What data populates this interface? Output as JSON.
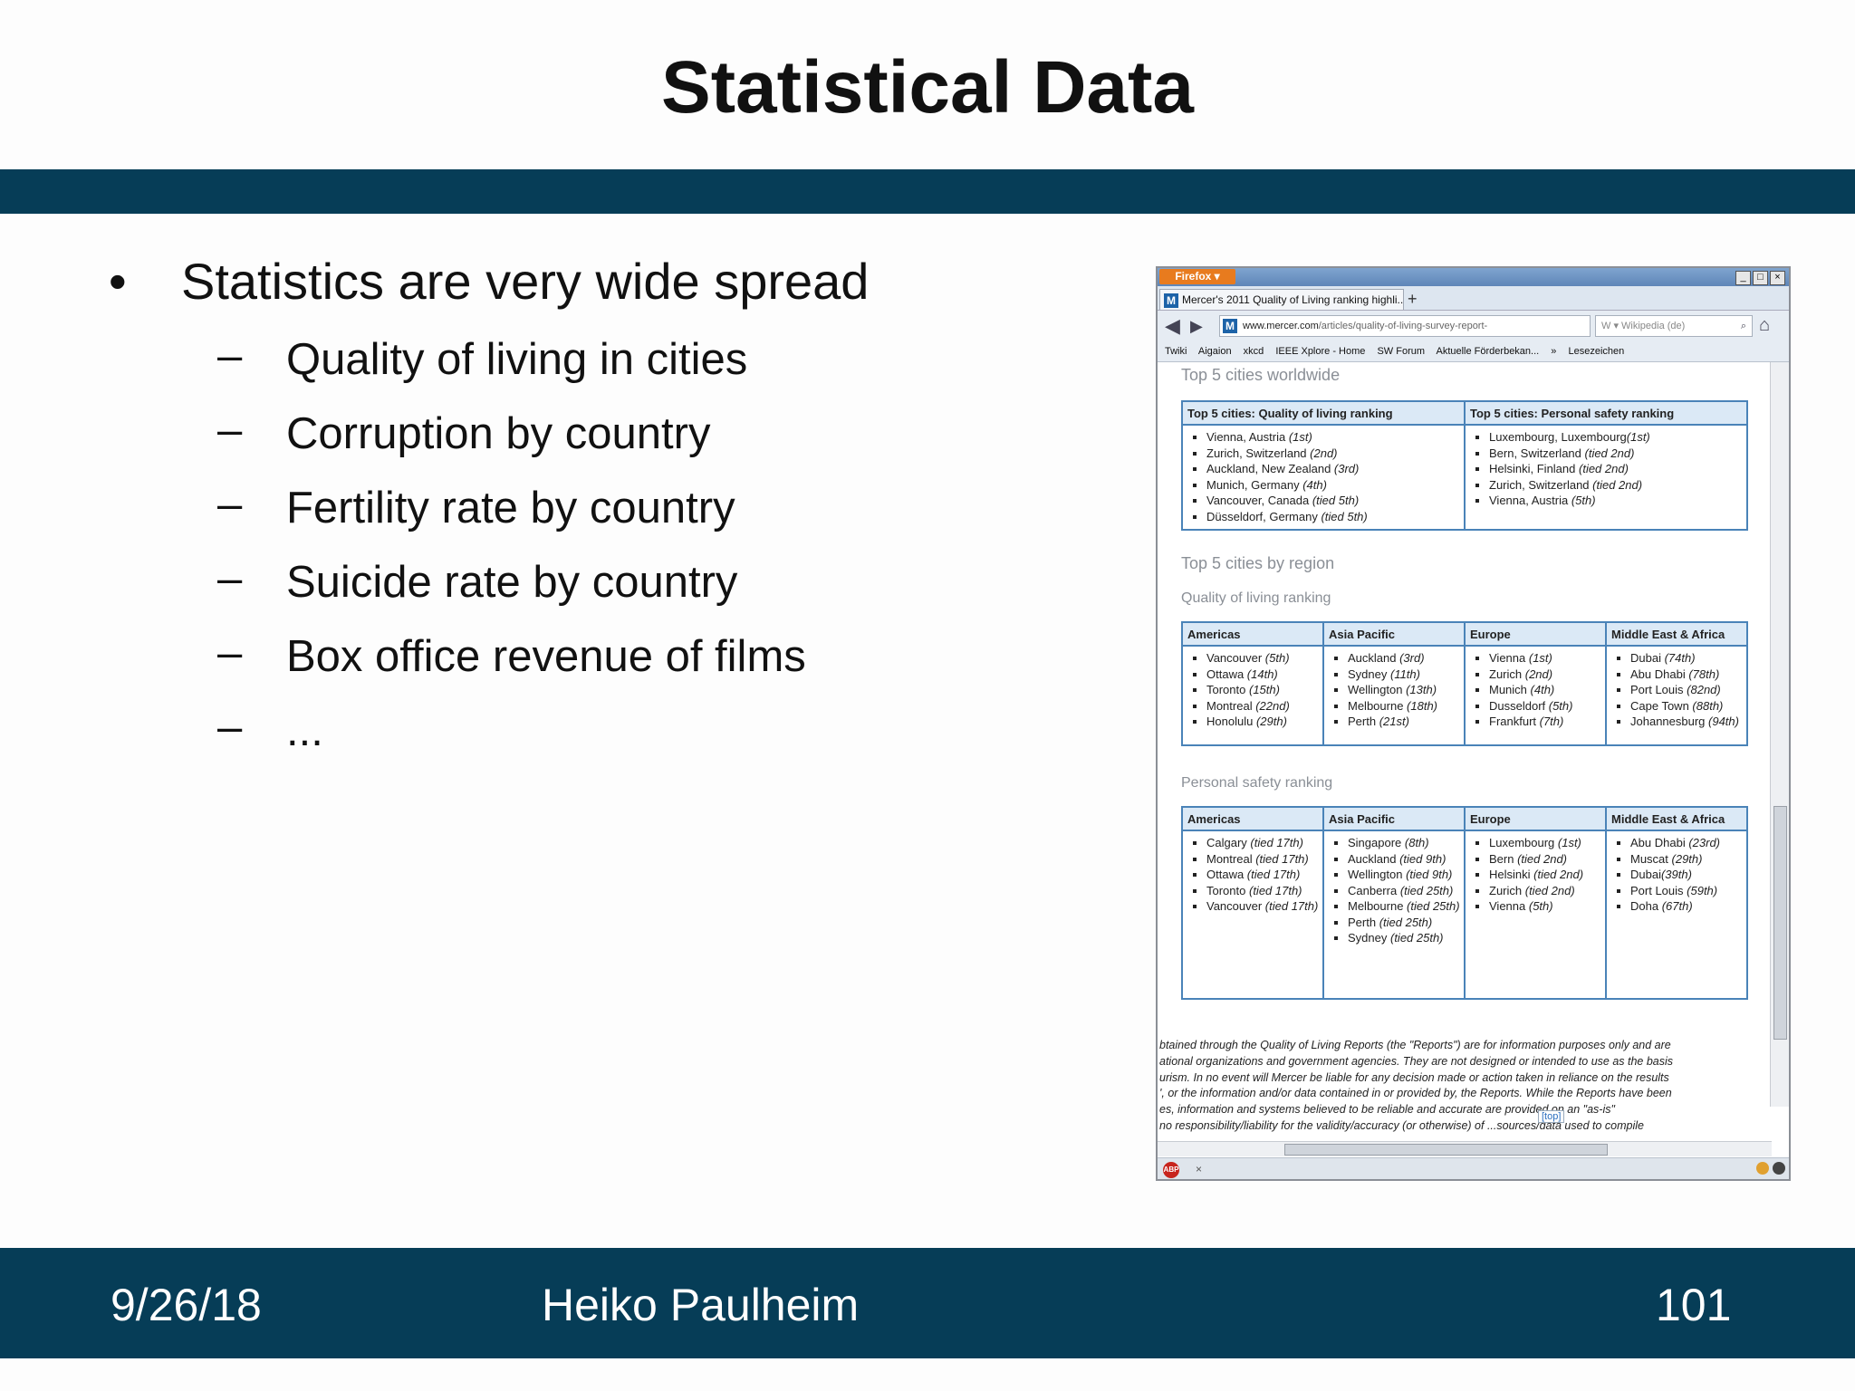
{
  "slide": {
    "title": "Statistical Data",
    "bullet": "Statistics are very wide spread",
    "bullet_glyph": "•",
    "dash_glyph": "–",
    "subbullets": [
      "Quality of living in cities",
      "Corruption by country",
      "Fertility rate by country",
      "Suicide rate by country",
      "Box office revenue of films",
      "..."
    ]
  },
  "footer": {
    "date": "9/26/18",
    "author": "Heiko Paulheim",
    "page": "101"
  },
  "browser": {
    "menu_button": "Firefox ▾",
    "tab_title": "Mercer's 2011 Quality of Living ranking highli...",
    "tab_favicon": "M",
    "new_tab": "+",
    "url_domain": "www.mercer.com",
    "url_path": "/articles/quality-of-living-survey-report-",
    "search_placeholder": "W ▾  Wikipedia (de)",
    "bookmarks": [
      "Twiki",
      "Aigaion",
      "xkcd",
      "IEEE Xplore - Home",
      "SW Forum",
      "Aktuelle Förderbekan...",
      "»",
      "Lesezeichen"
    ],
    "section_worldwide": "Top 5 cities worldwide",
    "worldwide_table": {
      "headers": [
        "Top 5 cities: Quality of living ranking",
        "Top 5 cities: Personal safety ranking"
      ],
      "quality": [
        {
          "name": "Vienna, Austria ",
          "rank": "(1st)"
        },
        {
          "name": "Zurich, Switzerland ",
          "rank": "(2nd)"
        },
        {
          "name": "Auckland, New Zealand ",
          "rank": "(3rd)"
        },
        {
          "name": "Munich, Germany ",
          "rank": "(4th)"
        },
        {
          "name": "Vancouver, Canada ",
          "rank": "(tied 5th)"
        },
        {
          "name": "Düsseldorf, Germany ",
          "rank": "(tied 5th)"
        }
      ],
      "safety": [
        {
          "name": "Luxembourg, Luxembourg",
          "rank": "(1st)"
        },
        {
          "name": "Bern, Switzerland ",
          "rank": "(tied 2nd)"
        },
        {
          "name": "Helsinki, Finland ",
          "rank": "(tied 2nd)"
        },
        {
          "name": "Zurich, Switzerland ",
          "rank": "(tied 2nd)"
        },
        {
          "name": "Vienna, Austria ",
          "rank": "(5th)"
        }
      ]
    },
    "section_region": "Top 5 cities by region",
    "subsection_quality": "Quality of living ranking",
    "region_headers": [
      "Americas",
      "Asia Pacific",
      "Europe",
      "Middle East & Africa"
    ],
    "quality_region": [
      [
        {
          "name": "Vancouver ",
          "rank": "(5th)"
        },
        {
          "name": "Ottawa ",
          "rank": "(14th)"
        },
        {
          "name": "Toronto ",
          "rank": "(15th)"
        },
        {
          "name": "Montreal ",
          "rank": "(22nd)"
        },
        {
          "name": "Honolulu ",
          "rank": "(29th)"
        }
      ],
      [
        {
          "name": "Auckland ",
          "rank": "(3rd)"
        },
        {
          "name": "Sydney ",
          "rank": "(11th)"
        },
        {
          "name": "Wellington ",
          "rank": "(13th)"
        },
        {
          "name": "Melbourne ",
          "rank": "(18th)"
        },
        {
          "name": "Perth ",
          "rank": "(21st)"
        }
      ],
      [
        {
          "name": "Vienna ",
          "rank": "(1st)"
        },
        {
          "name": "Zurich ",
          "rank": "(2nd)"
        },
        {
          "name": "Munich ",
          "rank": "(4th)"
        },
        {
          "name": "Dusseldorf ",
          "rank": "(5th)"
        },
        {
          "name": "Frankfurt ",
          "rank": "(7th)"
        }
      ],
      [
        {
          "name": "Dubai ",
          "rank": "(74th)"
        },
        {
          "name": "Abu Dhabi ",
          "rank": "(78th)"
        },
        {
          "name": "Port Louis ",
          "rank": "(82nd)"
        },
        {
          "name": "Cape Town ",
          "rank": "(88th)"
        },
        {
          "name": "Johannesburg ",
          "rank": "(94th)"
        }
      ]
    ],
    "subsection_safety": "Personal safety ranking",
    "safety_region": [
      [
        {
          "name": "Calgary ",
          "rank": "(tied 17th)"
        },
        {
          "name": "Montreal ",
          "rank": "(tied 17th)"
        },
        {
          "name": "Ottawa ",
          "rank": "(tied 17th)"
        },
        {
          "name": "Toronto ",
          "rank": "(tied 17th)"
        },
        {
          "name": "Vancouver ",
          "rank": "(tied 17th)"
        }
      ],
      [
        {
          "name": "Singapore ",
          "rank": "(8th)"
        },
        {
          "name": "Auckland ",
          "rank": "(tied 9th)"
        },
        {
          "name": "Wellington ",
          "rank": "(tied 9th)"
        },
        {
          "name": "Canberra ",
          "rank": "(tied 25th)"
        },
        {
          "name": "Melbourne ",
          "rank": "(tied 25th)"
        },
        {
          "name": "Perth ",
          "rank": "(tied 25th)"
        },
        {
          "name": "Sydney ",
          "rank": "(tied 25th)"
        }
      ],
      [
        {
          "name": "Luxembourg ",
          "rank": "(1st)"
        },
        {
          "name": "Bern ",
          "rank": "(tied 2nd)"
        },
        {
          "name": "Helsinki ",
          "rank": "(tied 2nd)"
        },
        {
          "name": "Zurich ",
          "rank": "(tied 2nd)"
        },
        {
          "name": "Vienna ",
          "rank": "(5th)"
        }
      ],
      [
        {
          "name": "Abu Dhabi ",
          "rank": "(23rd)"
        },
        {
          "name": "Muscat ",
          "rank": "(29th)"
        },
        {
          "name": "Dubai",
          "rank": "(39th)"
        },
        {
          "name": "Port Louis ",
          "rank": "(59th)"
        },
        {
          "name": "Doha ",
          "rank": "(67th)"
        }
      ]
    ],
    "fineprint": [
      "btained through the Quality of Living Reports (the \"Reports\") are for information purposes only and are",
      "ational organizations and government agencies. They are not designed or intended to use as the basis",
      "urism. In no event will Mercer be liable for any decision made or action taken in reliance on the results",
      "', or the information and/or data contained in or provided by, the Reports. While the Reports have been",
      "es, information and systems believed to be reliable and accurate          are provided on an \"as-is\"",
      "no responsibility/liability for the validity/accuracy (or otherwise) of ...sources/data used to compile"
    ],
    "top_link": "[top]",
    "abp_label": "ABP",
    "close_glyph": "×"
  }
}
